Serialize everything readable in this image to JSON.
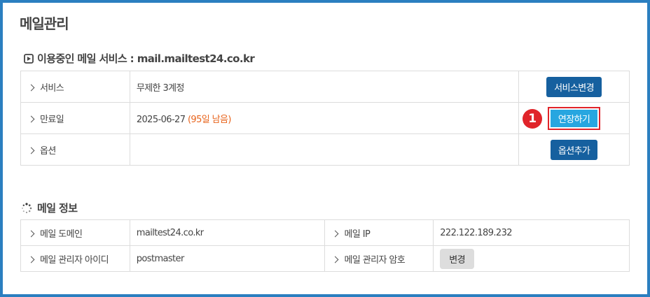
{
  "page_title": "메일관리",
  "service_section": {
    "heading": "이용중인 메일 서비스 : mail.mailtest24.co.kr",
    "rows": [
      {
        "label": "서비스",
        "value": "무제한 3계정",
        "button": "서비스변경"
      },
      {
        "label": "만료일",
        "value": "2025-06-27",
        "remaining": "(95일 남음)",
        "button": "연장하기",
        "badge": "1"
      },
      {
        "label": "옵션",
        "value": "",
        "button": "옵션추가"
      }
    ]
  },
  "mail_info_section": {
    "heading": "메일 정보",
    "domain_label": "메일 도메인",
    "domain_value": "mailtest24.co.kr",
    "ip_label": "메일 IP",
    "ip_value": "222.122.189.232",
    "admin_id_label": "메일 관리자 아이디",
    "admin_id_value": "postmaster",
    "admin_pw_label": "메일 관리자 암호",
    "admin_pw_button": "변경"
  },
  "colors": {
    "frame": "#2b7fc0",
    "primary_button": "#16609f",
    "highlight_button": "#27a6e0",
    "highlight_border": "#e0242a",
    "remaining_text": "#e8641d"
  }
}
